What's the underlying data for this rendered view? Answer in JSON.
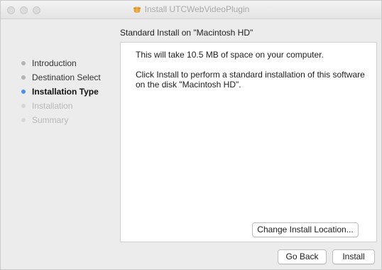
{
  "window": {
    "title": "Install UTCWebVideoPlugin"
  },
  "header": {
    "subtitle": "Standard Install on \"Macintosh HD\""
  },
  "sidebar": {
    "steps": [
      {
        "label": "Introduction",
        "state": "done"
      },
      {
        "label": "Destination Select",
        "state": "done"
      },
      {
        "label": "Installation Type",
        "state": "active"
      },
      {
        "label": "Installation",
        "state": "pending"
      },
      {
        "label": "Summary",
        "state": "pending"
      }
    ]
  },
  "content": {
    "space_text": "This will take 10.5 MB of space on your computer.",
    "install_text": "Click Install to perform a standard installation of this software on the disk \"Macintosh HD\".",
    "change_location_label": "Change Install Location..."
  },
  "footer": {
    "go_back_label": "Go Back",
    "install_label": "Install"
  },
  "colors": {
    "active_dot": "#4a8ff0",
    "done_dot": "#b2b2b2",
    "pending_dot": "#d6d6d6",
    "package_icon": "#e8a33c"
  },
  "icons": {
    "title_icon": "package-icon"
  }
}
